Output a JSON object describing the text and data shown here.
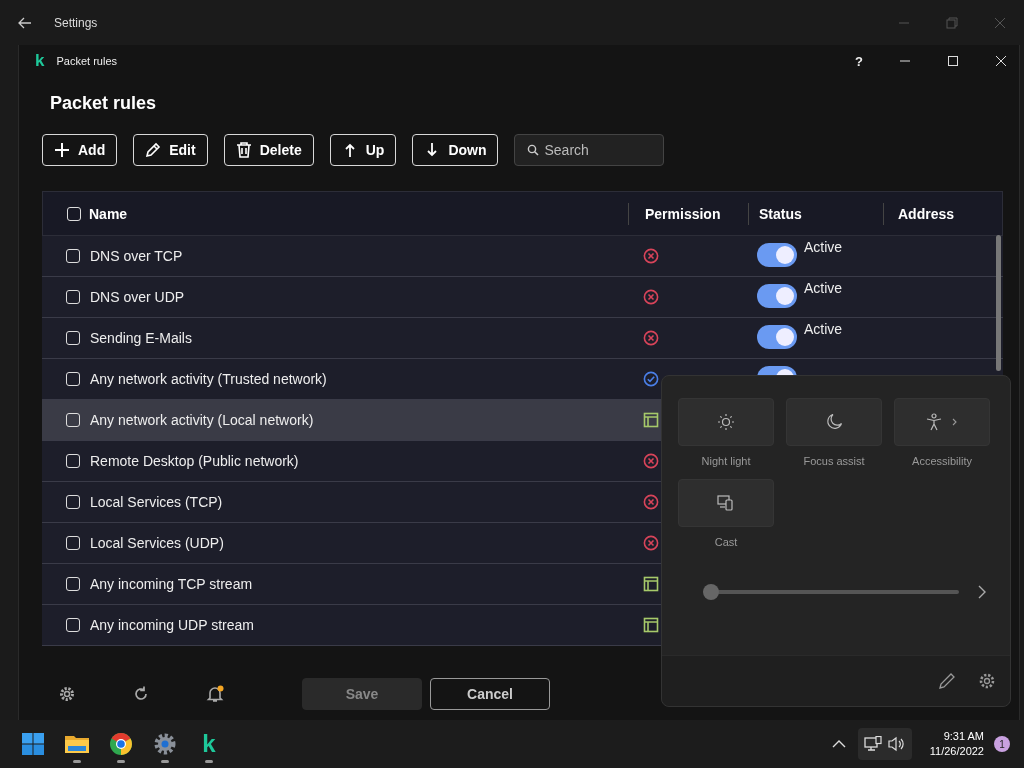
{
  "settings_window": {
    "title": "Settings"
  },
  "app_window": {
    "logo": "k",
    "title": "Packet rules",
    "help": "?"
  },
  "heading": "Packet rules",
  "toolbar": {
    "buttons": [
      {
        "label": "Add",
        "kind": "add"
      },
      {
        "label": "Edit",
        "kind": "edit"
      },
      {
        "label": "Delete",
        "kind": "delete"
      },
      {
        "label": "Up",
        "kind": "up"
      },
      {
        "label": "Down",
        "kind": "down"
      }
    ],
    "search": {
      "placeholder": "Search"
    }
  },
  "table": {
    "select_all_checked": false,
    "columns": [
      "Name",
      "Permission",
      "Status",
      "Address"
    ],
    "rows": [
      {
        "name": "DNS over TCP",
        "checked": false,
        "selected": false,
        "kind": "block",
        "toggle": {
          "on": true
        },
        "status": "Active"
      },
      {
        "name": "DNS over UDP",
        "checked": false,
        "selected": false,
        "kind": "block",
        "toggle": {
          "on": true
        },
        "status": "Active"
      },
      {
        "name": "Sending E-Mails",
        "checked": false,
        "selected": false,
        "kind": "block",
        "toggle": {
          "on": true
        },
        "status": "Active"
      },
      {
        "name": "Any network activity (Trusted network)",
        "checked": false,
        "selected": false,
        "kind": "allow",
        "toggle": {
          "on": true
        }
      },
      {
        "name": "Any network activity (Local network)",
        "checked": false,
        "selected": true,
        "kind": "log"
      },
      {
        "name": "Remote Desktop (Public network)",
        "checked": false,
        "selected": false,
        "kind": "block"
      },
      {
        "name": "Local Services (TCP)",
        "checked": false,
        "selected": false,
        "kind": "block"
      },
      {
        "name": "Local Services (UDP)",
        "checked": false,
        "selected": false,
        "kind": "block"
      },
      {
        "name": "Any incoming TCP stream",
        "checked": false,
        "selected": false,
        "kind": "log"
      },
      {
        "name": "Any incoming UDP stream",
        "checked": false,
        "selected": false,
        "kind": "log"
      }
    ]
  },
  "footer": {
    "bell_alert": true,
    "save": {
      "label": "Save",
      "disabled": true
    },
    "cancel": {
      "label": "Cancel",
      "disabled": false
    }
  },
  "quick_settings": {
    "tiles": [
      {
        "label": "Night light",
        "kind": "night-light",
        "on": false
      },
      {
        "label": "Focus assist",
        "kind": "focus",
        "on": false
      },
      {
        "label": "Accessibility",
        "kind": "accessibility",
        "on": false
      },
      {
        "label": "Cast",
        "kind": "cast",
        "on": false
      }
    ],
    "brightness": {
      "level": 0
    }
  },
  "taskbar": {
    "apps": [
      {
        "kind": "start",
        "running": false
      },
      {
        "kind": "folder",
        "running": true
      },
      {
        "kind": "chrome",
        "running": true
      },
      {
        "kind": "settings",
        "running": true
      },
      {
        "kind": "logo",
        "label": "k",
        "running": true
      }
    ],
    "time": "9:31 AM",
    "date": "11/26/2022",
    "notification_count": "1"
  }
}
